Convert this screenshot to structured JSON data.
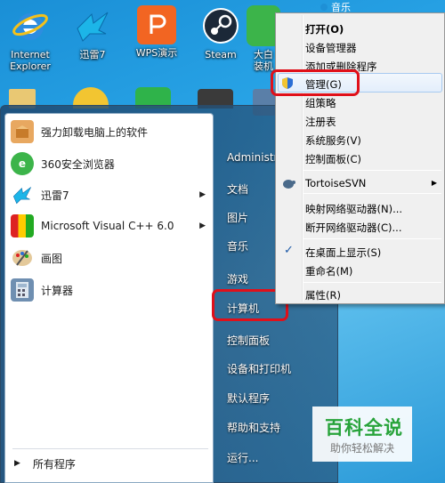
{
  "desktop_icons": [
    {
      "label": "Internet\nExplorer",
      "icon": "internet-explorer-icon"
    },
    {
      "label": "迅雷7",
      "icon": "xunlei-bird-icon"
    },
    {
      "label": "WPS演示",
      "icon": "wps-presentation-icon"
    },
    {
      "label": "Steam",
      "icon": "steam-icon"
    },
    {
      "label": "大白\n装机",
      "icon": "dabai-icon"
    }
  ],
  "start_menu": {
    "programs": [
      {
        "label": "强力卸载电脑上的软件",
        "icon": "uninstall-box-icon",
        "has_arrow": false
      },
      {
        "label": "360安全浏览器",
        "icon": "360-browser-icon",
        "has_arrow": false
      },
      {
        "label": "迅雷7",
        "icon": "xunlei-bird-icon",
        "has_arrow": true
      },
      {
        "label": "Microsoft Visual C++ 6.0",
        "icon": "visual-cpp-icon",
        "has_arrow": true
      },
      {
        "label": "画图",
        "icon": "paint-palette-icon",
        "has_arrow": false
      },
      {
        "label": "计算器",
        "icon": "calculator-icon",
        "has_arrow": false
      }
    ],
    "all_programs": "所有程序",
    "right": [
      "Administra",
      "文档",
      "图片",
      "音乐",
      "游戏",
      "计算机",
      "控制面板",
      "设备和打印机",
      "默认程序",
      "帮助和支持",
      "运行..."
    ]
  },
  "context_menu": {
    "top_partial": "音乐",
    "items": [
      "打开(O)",
      "设备管理器",
      "添加或删除程序",
      "管理(G)",
      "组策略",
      "注册表",
      "系统服务(V)",
      "控制面板(C)",
      "TortoiseSVN",
      "映射网络驱动器(N)...",
      "断开网络驱动器(C)...",
      "在桌面上显示(S)",
      "重命名(M)",
      "属性(R)"
    ]
  },
  "watermark": {
    "title": "百科全说",
    "subtitle": "助你轻松解决"
  },
  "colors": {
    "highlight": "#e0101a",
    "menu_bg": "#f0f0f0",
    "accent": "#1e90d6",
    "watermark_green": "#27a33a"
  }
}
